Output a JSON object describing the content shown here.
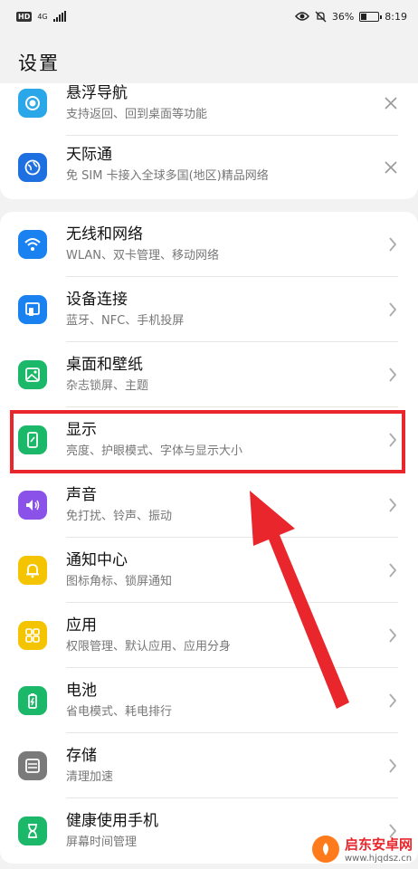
{
  "status": {
    "hd_label": "HD",
    "network_label": "4G",
    "battery_percent_label": "36%",
    "battery_level": 0.36,
    "time": "8:19"
  },
  "page_title": "设置",
  "partial_items": [
    {
      "title": "悬浮导航",
      "subtitle": "支持返回、回到桌面等功能",
      "icon": "navigation-dock-icon",
      "color": "#2aa7e8",
      "action": "close"
    },
    {
      "title": "天际通",
      "subtitle": "免 SIM 卡接入全球多国(地区)精品网络",
      "icon": "globe-icon",
      "color": "#1e6fe0",
      "action": "close"
    }
  ],
  "items": [
    {
      "title": "无线和网络",
      "subtitle": "WLAN、双卡管理、移动网络",
      "icon": "wifi-icon",
      "color": "#1a82f0"
    },
    {
      "title": "设备连接",
      "subtitle": "蓝牙、NFC、手机投屏",
      "icon": "device-connect-icon",
      "color": "#1a82f0"
    },
    {
      "title": "桌面和壁纸",
      "subtitle": "杂志锁屏、主题",
      "icon": "wallpaper-icon",
      "color": "#1cb86a"
    },
    {
      "title": "显示",
      "subtitle": "亮度、护眼模式、字体与显示大小",
      "icon": "display-icon",
      "color": "#1cb86a"
    },
    {
      "title": "声音",
      "subtitle": "免打扰、铃声、振动",
      "icon": "sound-icon",
      "color": "#8a52e8"
    },
    {
      "title": "通知中心",
      "subtitle": "图标角标、锁屏通知",
      "icon": "bell-icon",
      "color": "#f5c400"
    },
    {
      "title": "应用",
      "subtitle": "权限管理、默认应用、应用分身",
      "icon": "apps-grid-icon",
      "color": "#f5c400"
    },
    {
      "title": "电池",
      "subtitle": "省电模式、耗电排行",
      "icon": "battery-icon",
      "color": "#1cb86a"
    },
    {
      "title": "存储",
      "subtitle": "清理加速",
      "icon": "storage-icon",
      "color": "#7a7a7a"
    },
    {
      "title": "健康使用手机",
      "subtitle": "屏幕时间管理",
      "icon": "hourglass-icon",
      "color": "#1cb86a"
    }
  ],
  "watermark": {
    "line1": "启东安卓网",
    "line2": "www.hjqdsz.cn"
  },
  "colors": {
    "highlight": "#e8262b",
    "arrow": "#e8262b"
  }
}
